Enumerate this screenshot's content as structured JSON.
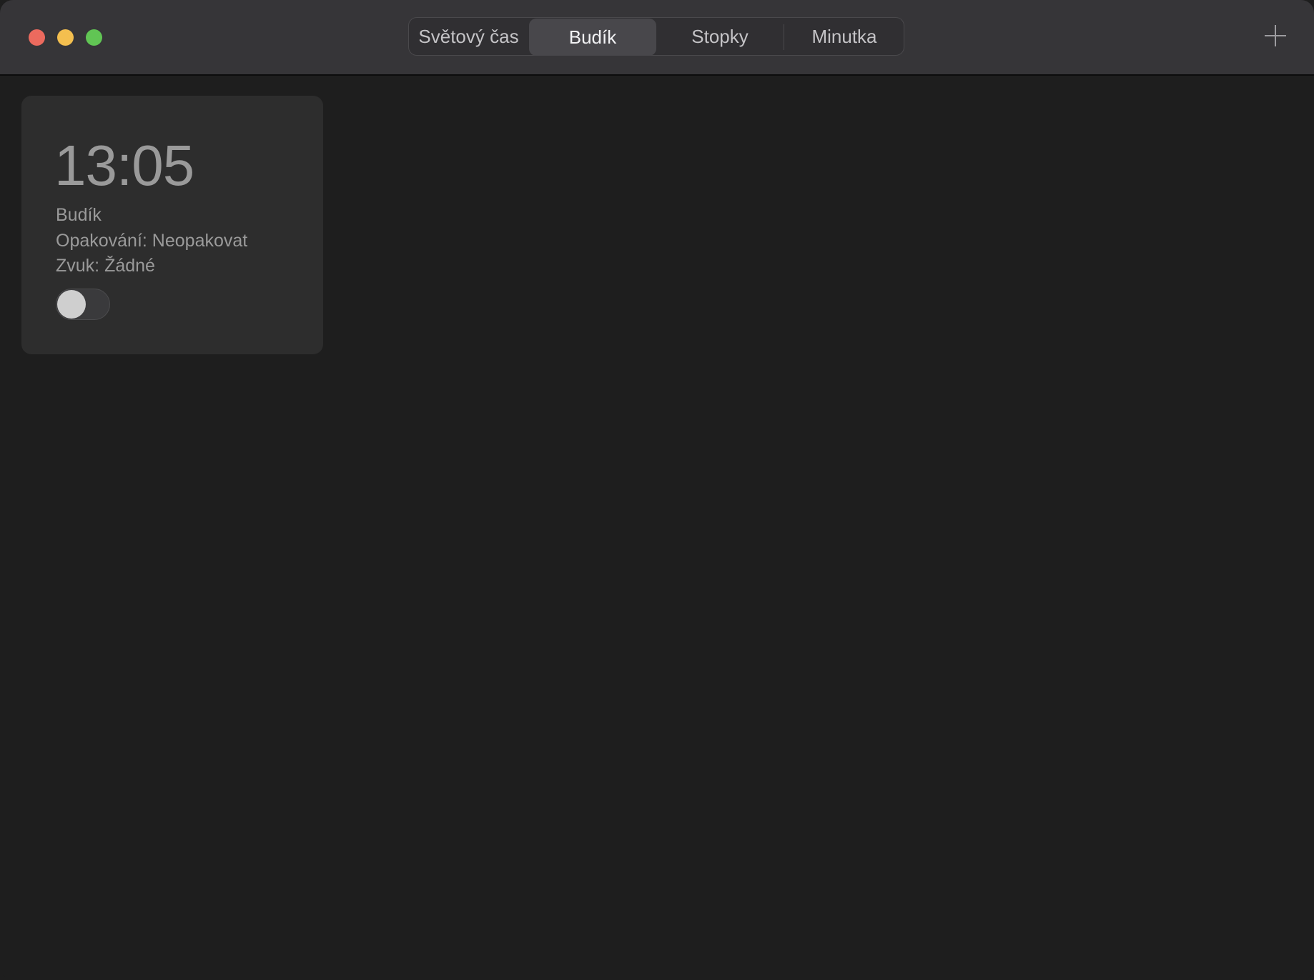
{
  "window": {
    "controls": [
      "close",
      "minimize",
      "zoom"
    ]
  },
  "tabs": [
    {
      "label": "Světový čas",
      "selected": false
    },
    {
      "label": "Budík",
      "selected": true
    },
    {
      "label": "Stopky",
      "selected": false
    },
    {
      "label": "Minutka",
      "selected": false
    }
  ],
  "toolbar": {
    "add_icon": "plus-icon"
  },
  "alarm": {
    "time": "13:05",
    "label": "Budík",
    "repeat": "Opakování: Neopakovat",
    "sound": "Zvuk: Žádné",
    "enabled": false
  },
  "colors": {
    "close": "#ec6a5e",
    "minimize": "#f4bf4f",
    "zoom": "#61c554",
    "background": "#1e1e1e",
    "card": "#2d2d2d"
  }
}
